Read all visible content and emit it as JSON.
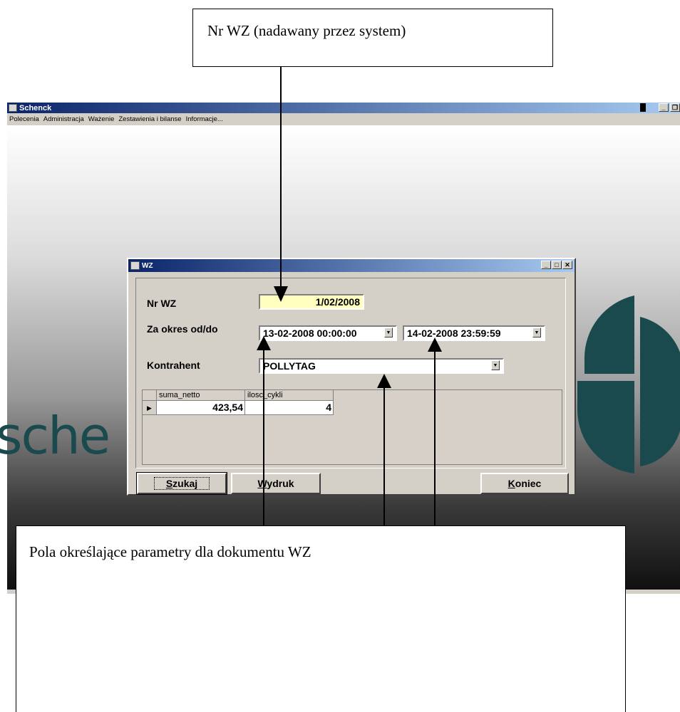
{
  "annotations": {
    "top_callout": "Nr WZ (nadawany przez system)",
    "bottom_callout": "Pola określające parametry dla dokumentu WZ"
  },
  "app": {
    "title": "Schenck",
    "menu": [
      "Polecenia",
      "Administracja",
      "Ważenie",
      "Zestawienia i bilanse",
      "Informacje..."
    ],
    "logo_text": "sche"
  },
  "dialog": {
    "title": "WZ",
    "labels": {
      "nr_wz": "Nr WZ",
      "okres": "Za okres od/do",
      "kontrahent": "Kontrahent"
    },
    "nr_wz_value": "1/02/2008",
    "date_from": "13-02-2008 00:00:00",
    "date_to": "14-02-2008 23:59:59",
    "kontrahent_value": "POLLYTAG",
    "grid": {
      "columns": [
        "suma_netto",
        "ilosc_cykli"
      ],
      "rows": [
        [
          "423,54",
          "4"
        ]
      ]
    },
    "buttons": {
      "szukaj_u": "S",
      "szukaj_rest": "zukaj",
      "wydruk_u": "W",
      "wydruk_rest": "ydruk",
      "koniec_u": "K",
      "koniec_rest": "oniec"
    }
  },
  "colors": {
    "title_gradient_start": "#0a246a",
    "title_gradient_end": "#a6caf0",
    "nr_wz_background": "#ffffc0",
    "logo": "#1a4a4e"
  }
}
